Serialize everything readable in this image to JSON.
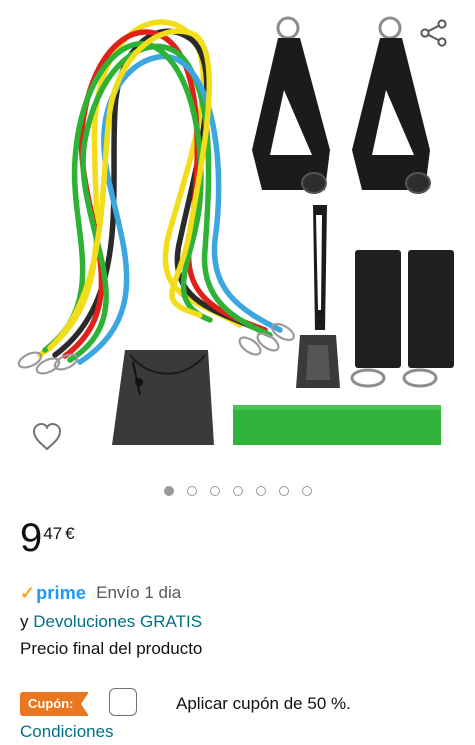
{
  "gallery": {
    "image_alt": "Resistance bands set",
    "dots_total": 7,
    "active_dot": 0
  },
  "icons": {
    "share": "share-icon",
    "wishlist": "heart-icon"
  },
  "price": {
    "whole": "9",
    "fraction": "47",
    "currency": "€"
  },
  "delivery": {
    "prime_check": "✓",
    "prime_label": "prime",
    "shipping": "Envío 1 dia",
    "returns_prefix": "y",
    "returns_link": "Devoluciones GRATIS",
    "final_price_note": "Precio final del producto"
  },
  "coupon": {
    "badge": "Cupón:",
    "text": "Aplicar cupón de 50 %.",
    "conditions": "Condiciones",
    "checked": false
  },
  "colors": {
    "link": "#007185",
    "prime_blue": "#1a98ff",
    "prime_check": "#f7a71e",
    "coupon_badge": "#e8771f"
  }
}
